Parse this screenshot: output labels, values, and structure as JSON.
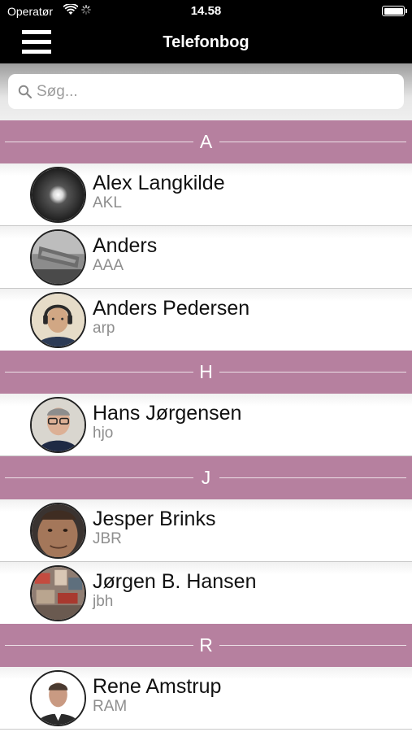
{
  "status_bar": {
    "carrier": "Operatør",
    "time": "14.58"
  },
  "nav": {
    "title": "Telefonbog"
  },
  "search": {
    "placeholder": "Søg..."
  },
  "sections": [
    {
      "letter": "A",
      "contacts": [
        {
          "name": "Alex Langkilde",
          "initials": "AKL"
        },
        {
          "name": "Anders",
          "initials": "AAA"
        },
        {
          "name": "Anders Pedersen",
          "initials": "arp"
        }
      ]
    },
    {
      "letter": "H",
      "contacts": [
        {
          "name": "Hans Jørgensen",
          "initials": "hjo"
        }
      ]
    },
    {
      "letter": "J",
      "contacts": [
        {
          "name": "Jesper Brinks",
          "initials": "JBR"
        },
        {
          "name": "Jørgen B. Hansen",
          "initials": "jbh"
        }
      ]
    },
    {
      "letter": "R",
      "contacts": [
        {
          "name": "Rene Amstrup",
          "initials": "RAM"
        }
      ]
    }
  ],
  "colors": {
    "section_header": "#b6809f",
    "nav_background": "#000000",
    "placeholder": "#9c9c9c"
  },
  "icons": {
    "menu": "hamburger-icon",
    "search": "magnifier-icon",
    "wifi": "wifi-icon",
    "activity": "spinner-icon",
    "battery": "battery-icon"
  }
}
